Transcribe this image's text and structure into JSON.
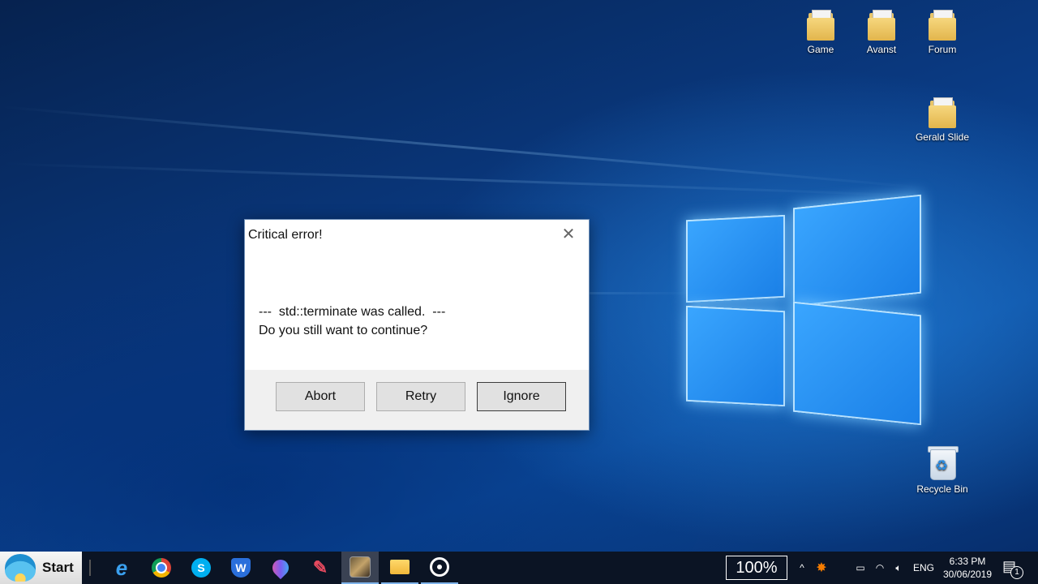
{
  "desktop": {
    "icons": [
      {
        "label": "Game",
        "icon": "folder-icon"
      },
      {
        "label": "Avanst",
        "icon": "folder-icon"
      },
      {
        "label": "Forum",
        "icon": "folder-icon"
      },
      {
        "label": "Gerald Slide",
        "icon": "folder-icon"
      },
      {
        "label": "Recycle Bin",
        "icon": "recycle-bin-icon"
      }
    ]
  },
  "dialog": {
    "title": "Critical error!",
    "message_line1": "---  std::terminate was called.  ---",
    "message_line2": "Do you still want to continue?",
    "buttons": {
      "abort": "Abort",
      "retry": "Retry",
      "ignore": "Ignore"
    },
    "close_glyph": "✕"
  },
  "taskbar": {
    "start_label": "Start",
    "pinned": [
      {
        "icon": "internet-explorer-icon"
      },
      {
        "icon": "chrome-icon"
      },
      {
        "icon": "skype-icon"
      },
      {
        "icon": "wps-office-icon"
      },
      {
        "icon": "paint-3d-icon"
      },
      {
        "icon": "paint-brush-app-icon"
      },
      {
        "icon": "game-app-icon"
      },
      {
        "icon": "file-explorer-icon"
      },
      {
        "icon": "groove-music-icon"
      }
    ],
    "zoom": "100%",
    "language": "ENG",
    "time": "6:33 PM",
    "date": "30/06/2019",
    "notification_count": "1"
  },
  "colors": {
    "taskbar_bg": "#0b1424",
    "dialog_footer": "#f0f0f0",
    "accent": "#7fb3ea"
  }
}
